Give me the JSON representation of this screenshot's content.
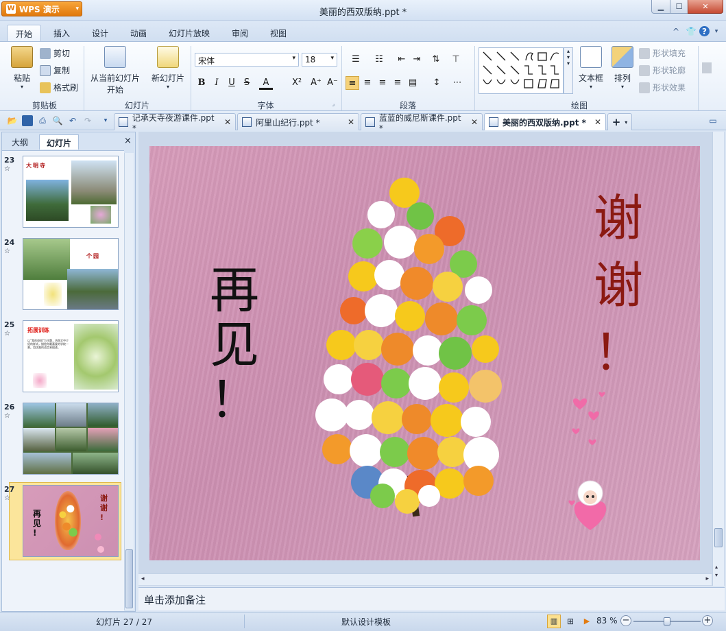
{
  "app": {
    "name": "WPS 演示",
    "logo_letter": "W"
  },
  "window": {
    "title": "美丽的西双版纳.ppt *"
  },
  "menu": {
    "tabs": [
      "开始",
      "插入",
      "设计",
      "动画",
      "幻灯片放映",
      "审阅",
      "视图"
    ],
    "active": "开始"
  },
  "ribbon": {
    "clipboard": {
      "paste": "粘贴",
      "cut": "剪切",
      "copy": "复制",
      "format_painter": "格式刷",
      "group": "剪贴板"
    },
    "slides": {
      "from_current_1": "从当前幻灯片",
      "from_current_2": "开始",
      "new_slide": "新幻灯片",
      "group": "幻灯片"
    },
    "font": {
      "family": "宋体",
      "size": "18",
      "bold": "B",
      "italic": "I",
      "underline": "U",
      "strike": "S",
      "color": "A",
      "superscript": "X²",
      "grow": "A⁺",
      "shrink": "A⁻",
      "group": "字体"
    },
    "paragraph": {
      "group": "段落"
    },
    "drawing": {
      "textbox": "文本框",
      "arrange": "排列",
      "shape_fill": "形状填充",
      "shape_outline": "形状轮廓",
      "shape_effect": "形状效果",
      "group": "绘图"
    }
  },
  "doc_tabs": [
    {
      "label": "记承天寺夜游课件.ppt *",
      "active": false
    },
    {
      "label": "阿里山纪行.ppt *",
      "active": false
    },
    {
      "label": "蓝蓝的威尼斯课件.ppt *",
      "active": false
    },
    {
      "label": "美丽的西双版纳.ppt *",
      "active": true
    }
  ],
  "left_panel": {
    "tabs": [
      "大纲",
      "幻灯片"
    ],
    "active": "幻灯片",
    "close": "×",
    "thumbnails": [
      {
        "number": "23",
        "title": "大明寺"
      },
      {
        "number": "24",
        "title": "个园"
      },
      {
        "number": "25",
        "title": "拓展训练",
        "text": "以“我的校园”为主题，仿照文中介绍的样式，描绘你最喜爱的学校一景。用优美的语言来描述。"
      },
      {
        "number": "26"
      },
      {
        "number": "27",
        "selected": true,
        "left_text": "再见!",
        "right_text": "谢谢!"
      }
    ]
  },
  "slide": {
    "left_text": "再见！",
    "right_text": "谢谢！",
    "colors": {
      "left": "#111111",
      "right": "#8b1a12",
      "background": "#d49ab9"
    }
  },
  "notes": {
    "placeholder": "单击添加备注"
  },
  "status": {
    "slide_info": "幻灯片 27 / 27",
    "template": "默认设计模板",
    "zoom": "83 %",
    "zoom_level": 0.5
  },
  "icons": [
    "paste-icon",
    "cut-icon",
    "copy-icon",
    "format-painter-icon",
    "slideshow-icon",
    "new-slide-icon",
    "textbox-icon",
    "arrange-icon",
    "help-icon",
    "skin-icon",
    "minimize-icon",
    "maximize-icon",
    "close-icon",
    "open-icon",
    "save-icon",
    "print-icon",
    "preview-icon",
    "undo-icon",
    "redo-icon",
    "plus-icon",
    "normal-view-icon",
    "sorter-view-icon",
    "play-icon",
    "zoom-out-icon",
    "zoom-in-icon"
  ]
}
